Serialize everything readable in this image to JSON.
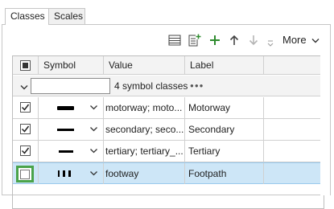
{
  "tabs": [
    {
      "label": "Classes",
      "active": true
    },
    {
      "label": "Scales",
      "active": false
    }
  ],
  "toolbar": {
    "more_label": "More",
    "icons": [
      "list-view-icon",
      "add-from-values-icon",
      "add-class-icon",
      "move-up-icon",
      "move-down-icon",
      "more-small-icon"
    ]
  },
  "grid": {
    "headers": {
      "symbol": "Symbol",
      "value": "Value",
      "label": "Label"
    },
    "group": {
      "input_value": "",
      "count_text": "4 symbol classes",
      "menu_glyph": "●●●"
    },
    "rows": [
      {
        "checked": true,
        "symbol_style": "thick",
        "value": "motorway; moto...",
        "label": "Motorway",
        "selected": false
      },
      {
        "checked": true,
        "symbol_style": "medium",
        "value": "secondary; seco...",
        "label": "Secondary",
        "selected": false
      },
      {
        "checked": true,
        "symbol_style": "medium-short",
        "value": "tertiary; tertiary_...",
        "label": "Tertiary",
        "selected": false
      },
      {
        "checked": false,
        "symbol_style": "dashed",
        "value": "footway",
        "label": "Footpath",
        "selected": true
      }
    ]
  },
  "colors": {
    "accent_green": "#4aa34a",
    "selection": "#cde6f7"
  }
}
